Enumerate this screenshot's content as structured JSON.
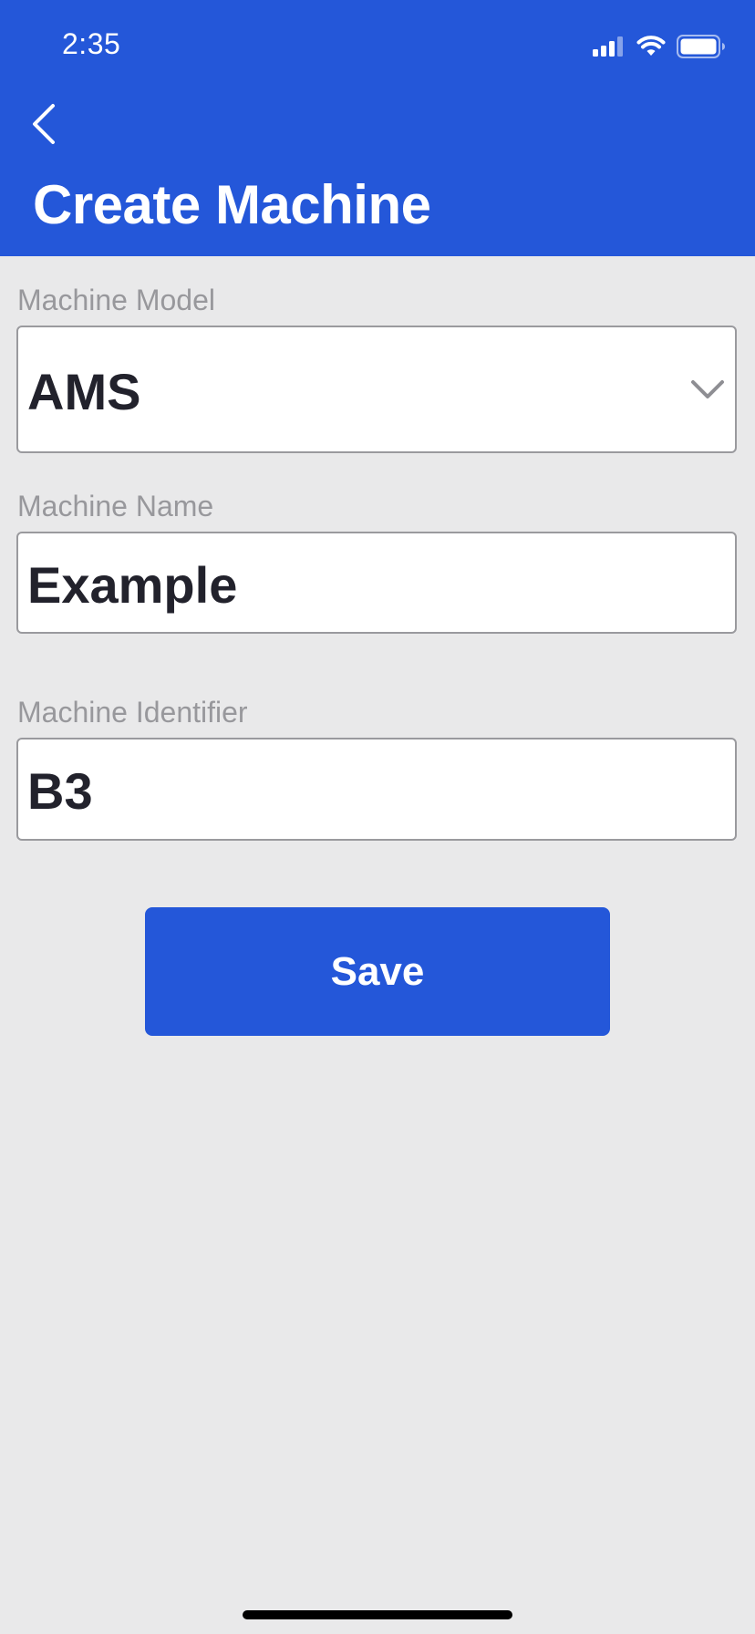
{
  "status_bar": {
    "time": "2:35",
    "icons": [
      "cellular-signal-icon",
      "wifi-icon",
      "battery-icon"
    ]
  },
  "header": {
    "back_icon": "chevron-left-icon",
    "title": "Create Machine"
  },
  "form": {
    "machine_model": {
      "label": "Machine Model",
      "value": "AMS",
      "dropdown_icon": "chevron-down-icon"
    },
    "machine_name": {
      "label": "Machine Name",
      "value": "Example"
    },
    "machine_identifier": {
      "label": "Machine Identifier",
      "value": "B3"
    }
  },
  "actions": {
    "save_label": "Save"
  },
  "colors": {
    "accent": "#2457d9",
    "background": "#e9e9ea",
    "label_text": "#98989c",
    "value_text": "#22222c"
  }
}
